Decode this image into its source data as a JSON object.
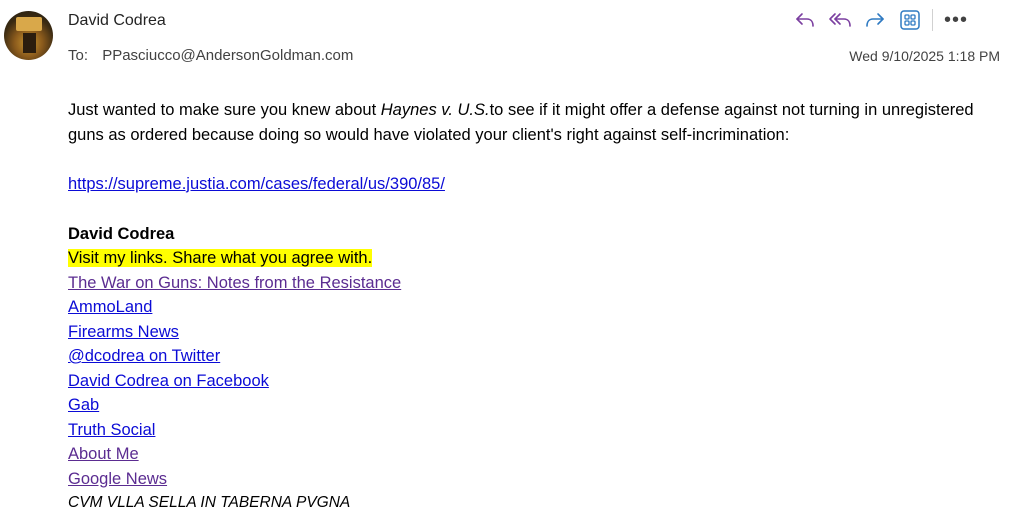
{
  "sender": {
    "name": "David Codrea"
  },
  "recipient": {
    "label": "To:",
    "address": "PPasciucco@AndersonGoldman.com"
  },
  "date": "Wed 9/10/2025 1:18 PM",
  "toolbar": {
    "icons": [
      "reply-icon",
      "reply-all-icon",
      "forward-icon",
      "apps-icon",
      "more-icon"
    ],
    "more_label": "•••"
  },
  "body": {
    "intro_before": "Just wanted to make sure you knew about ",
    "case_name": "Haynes v. U.S.",
    "intro_after": "to see if it might offer a defense against not turning in unregistered guns as ordered because doing so would have violated your client's right against self-incrimination:",
    "case_link": "https://supreme.justia.com/cases/federal/us/390/85/"
  },
  "signature": {
    "name": "David Codrea",
    "tagline": "Visit my links. Share what you agree with.",
    "links": [
      {
        "label": "The War on Guns: Notes from the Resistance",
        "visited": true
      },
      {
        "label": "AmmoLand",
        "visited": false
      },
      {
        "label": "Firearms News",
        "visited": false
      },
      {
        "label": "@dcodrea on Twitter",
        "visited": false
      },
      {
        "label": "David Codrea on Facebook",
        "visited": false
      },
      {
        "label": "Gab",
        "visited": false
      },
      {
        "label": "Truth Social",
        "visited": false
      },
      {
        "label": "About Me",
        "visited": true
      },
      {
        "label": "Google News",
        "visited": true
      }
    ],
    "motto": "CVM VLLA SELLA IN TABERNA PVGNA"
  },
  "colors": {
    "accent": "#7b3fa0",
    "forward": "#2f7ac2",
    "link": "#0b0bd6",
    "visited_link": "#5b2c91",
    "highlight": "#ffff00"
  }
}
